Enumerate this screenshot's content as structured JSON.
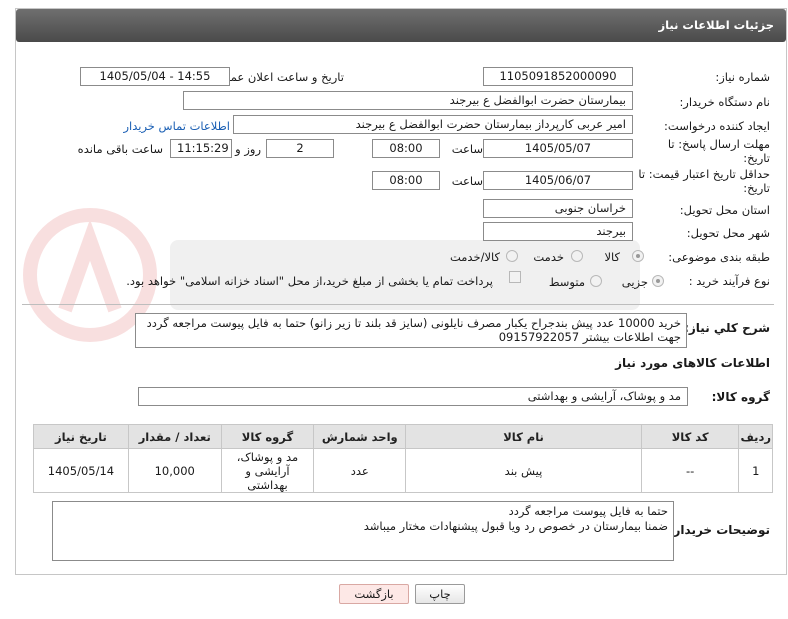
{
  "header": {
    "title": "جزئیات اطلاعات نیاز"
  },
  "fields": {
    "need_number_label": "شماره نیاز:",
    "need_number": "1105091852000090",
    "announce_label": "تاریخ و ساعت اعلان عمومی:",
    "announce_value": "1405/05/04 - 14:55",
    "buyer_org_label": "نام دستگاه خریدار:",
    "buyer_org": "بیمارستان حضرت ابوالفضل  ع  بیرجند",
    "creator_label": "ایجاد کننده درخواست:",
    "creator": "امیر عربی کارپرداز بیمارستان حضرت ابوالفضل  ع  بیرجند",
    "contact_link": "اطلاعات تماس خریدار",
    "reply_deadline_label": "مهلت ارسال پاسخ: تا تاریخ:",
    "reply_date": "1405/05/07",
    "time_label": "ساعت",
    "reply_time": "08:00",
    "days_value": "2",
    "days_label": "روز و",
    "remaining_time": "11:15:29",
    "remaining_label": "ساعت باقی مانده",
    "price_validity_label": "حداقل تاریخ اعتبار قیمت: تا تاریخ:",
    "price_date": "1405/06/07",
    "price_time": "08:00",
    "province_label": "استان محل تحویل:",
    "province": "خراسان جنوبی",
    "city_label": "شهر محل تحویل:",
    "city": "بیرجند",
    "category_label": "طبقه بندی موضوعی:",
    "category_options": [
      "کالا",
      "خدمت",
      "کالا/خدمت"
    ],
    "process_label": "نوع فرآیند خرید :",
    "process_options": [
      "جزیی",
      "متوسط"
    ],
    "payment_note": "پرداخت تمام یا بخشی از مبلغ خرید،از محل \"اسناد خزانه اسلامی\" خواهد بود."
  },
  "summary": {
    "label": "شرح کلي نياز:",
    "text": "خرید 10000 عدد پیش بندجراح یکبار مصرف نایلونی (سایز قد بلند تا زیر زانو) حتما به فایل پیوست مراجعه گردد جهت اطلاعات بیشتر 09157922057"
  },
  "goods_section": {
    "title": "اطلاعات کالاهای مورد نیاز",
    "group_label": "گروه کالا:",
    "group_value": "مد و پوشاک، آرایشی و بهداشتی"
  },
  "table": {
    "headers": [
      "ردیف",
      "کد کالا",
      "نام کالا",
      "واحد شمارش",
      "گروه کالا",
      "تعداد / مقدار",
      "تاریخ نیاز"
    ],
    "rows": [
      [
        "1",
        "--",
        "پیش بند",
        "عدد",
        "مد و پوشاک، آرایشی و بهداشتی",
        "10,000",
        "1405/05/14"
      ]
    ]
  },
  "buyer_notes": {
    "label": "توضیحات خریدار:",
    "line1": "حتما به فایل پیوست مراجعه گردد",
    "line2": "ضمنا بیمارستان در خصوص رد ویا قبول پیشنهادات مختار میباشد"
  },
  "buttons": {
    "print": "چاپ",
    "back": "بازگشت"
  }
}
